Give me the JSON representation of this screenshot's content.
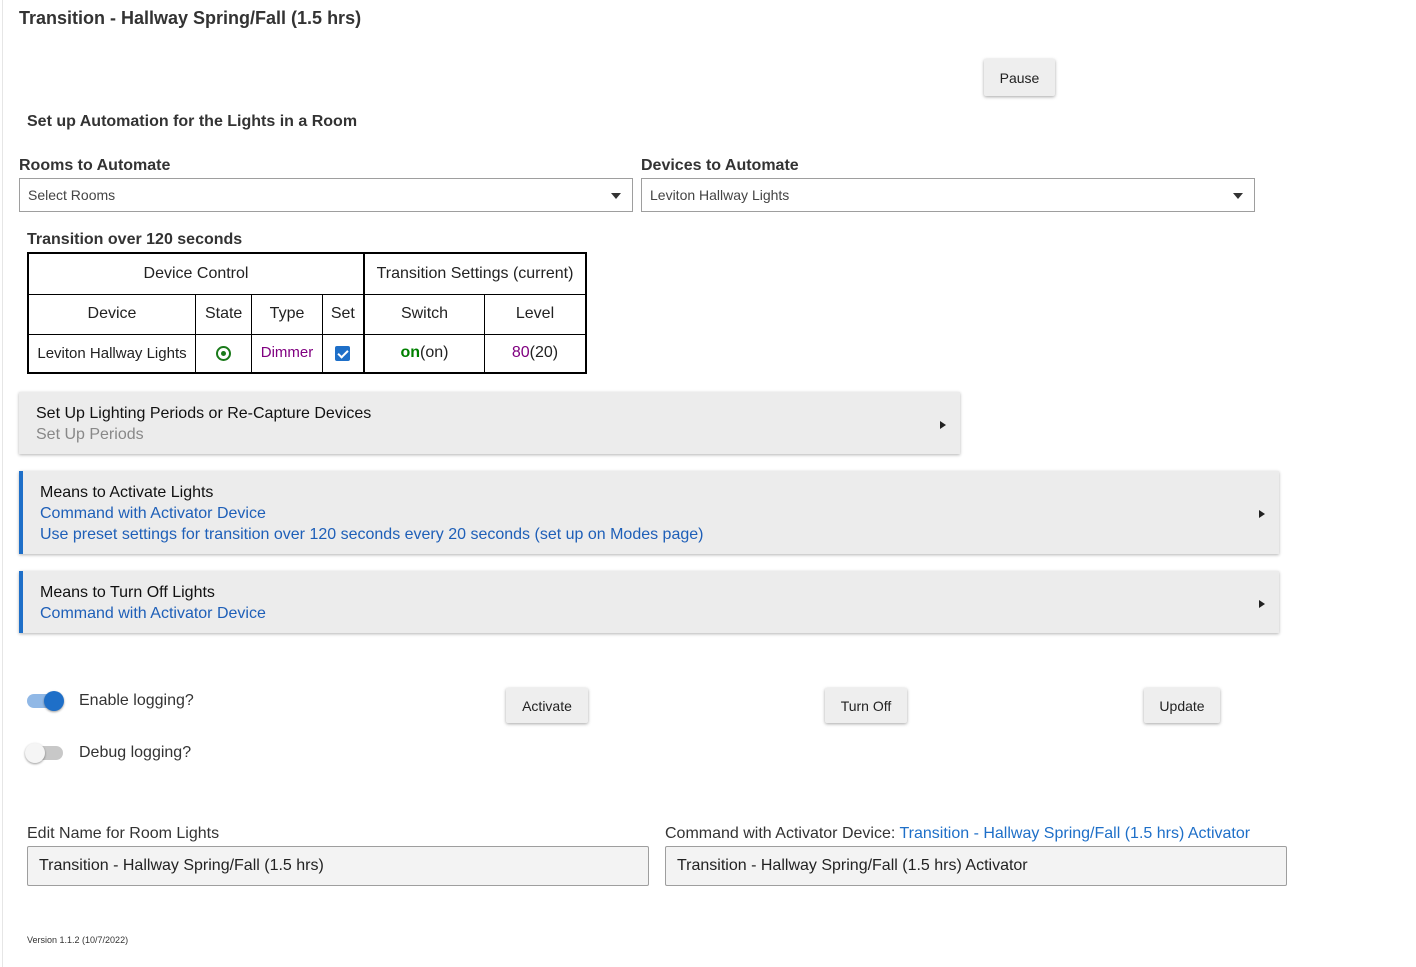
{
  "page": {
    "title": "Transition - Hallway Spring/Fall (1.5 hrs)",
    "pause_label": "Pause",
    "section_heading": "Set up Automation for the Lights in a Room"
  },
  "rooms": {
    "label": "Rooms to Automate",
    "placeholder": "Select Rooms"
  },
  "devices": {
    "label": "Devices to Automate",
    "selected": "Leviton Hallway Lights"
  },
  "transition_table": {
    "caption": "Transition over 120 seconds",
    "group_headers": [
      "Device Control",
      "Transition Settings (current)"
    ],
    "columns": [
      "Device",
      "State",
      "Type",
      "Set",
      "Switch",
      "Level"
    ],
    "rows": [
      {
        "device": "Leviton Hallway Lights",
        "state": "on",
        "type": "Dimmer",
        "set": true,
        "switch_value": "on",
        "switch_current": "(on)",
        "level_value": "80",
        "level_current": "(20)"
      }
    ]
  },
  "panels": {
    "periods": {
      "title": "Set Up Lighting Periods or Re-Capture Devices",
      "subtitle": "Set Up Periods"
    },
    "activate": {
      "title": "Means to Activate Lights",
      "line1": "Command with Activator Device",
      "line2": "Use preset settings for transition over 120 seconds every 20 seconds (set up on Modes page)"
    },
    "turn_off": {
      "title": "Means to Turn Off Lights",
      "line1": "Command with Activator Device"
    }
  },
  "logging": {
    "enable_label": "Enable logging?",
    "enable_on": true,
    "debug_label": "Debug logging?",
    "debug_on": false
  },
  "actions": {
    "activate": "Activate",
    "turn_off": "Turn Off",
    "update": "Update"
  },
  "name_field": {
    "label": "Edit Name for Room Lights",
    "value": "Transition - Hallway Spring/Fall (1.5 hrs)"
  },
  "activator_field": {
    "label_prefix": "Command with Activator Device: ",
    "label_link": "Transition - Hallway Spring/Fall (1.5 hrs) Activator",
    "value": "Transition - Hallway Spring/Fall (1.5 hrs) Activator"
  },
  "footer": {
    "version": "Version 1.1.2 (10/7/2022)"
  },
  "colors": {
    "accent": "#1e6fc8",
    "state_on": "#008000",
    "type_text": "#800080",
    "link_blue": "#1e5fb8"
  }
}
